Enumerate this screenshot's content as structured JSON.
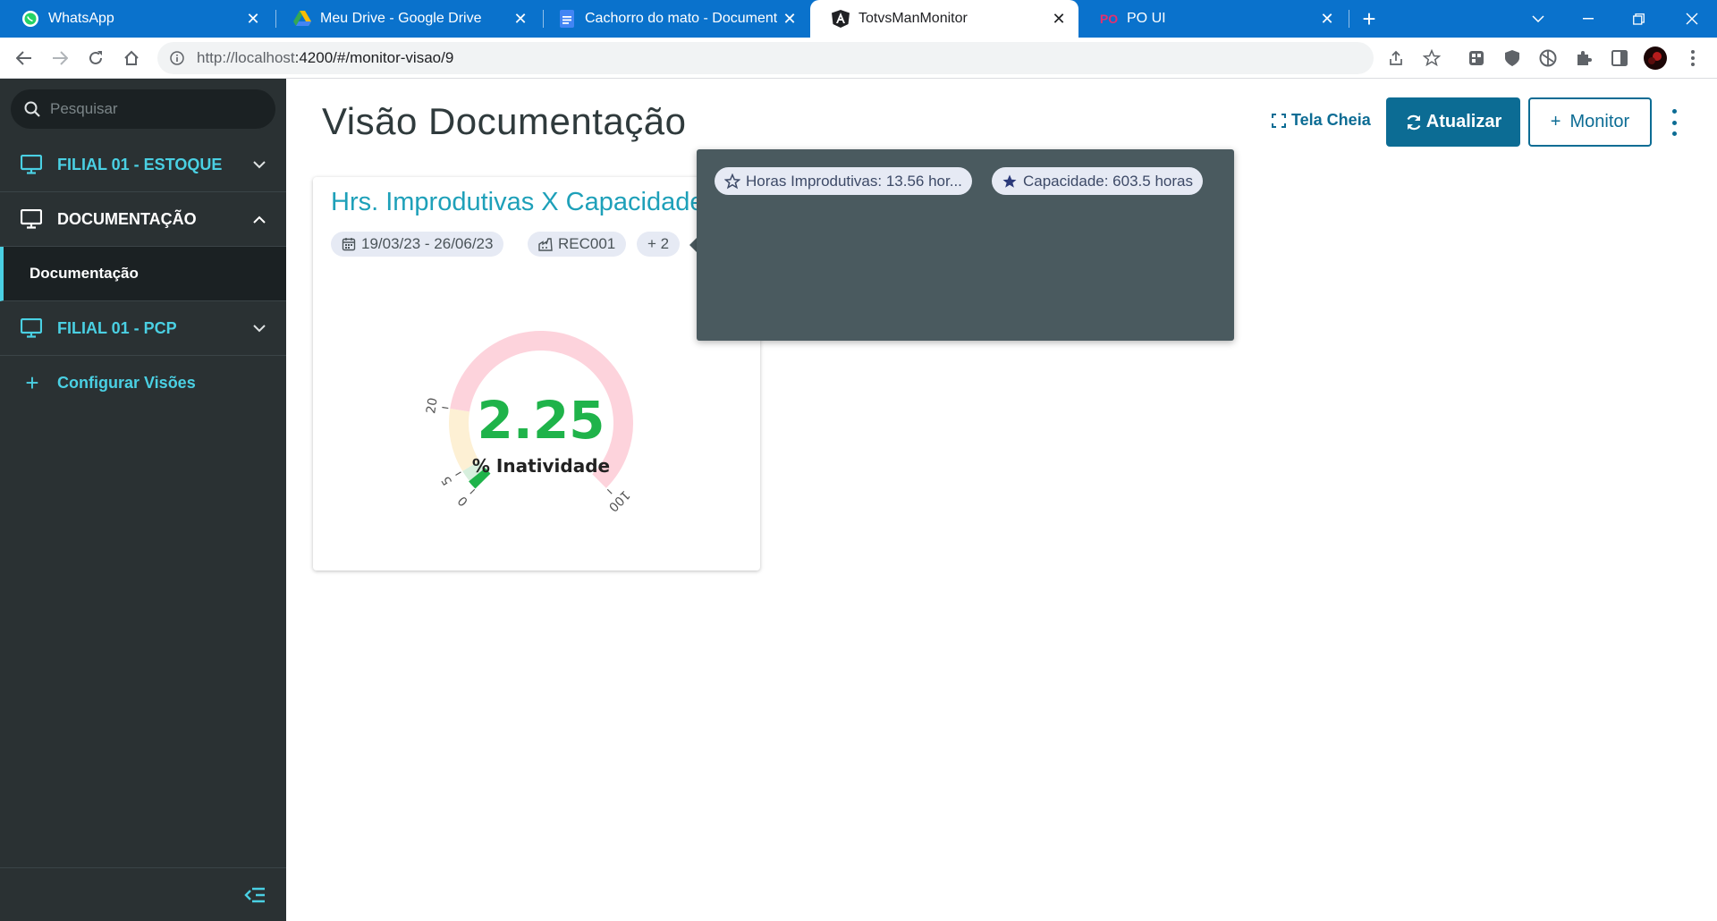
{
  "browser": {
    "tabs": [
      {
        "label": "WhatsApp",
        "icon": "whatsapp-icon"
      },
      {
        "label": "Meu Drive - Google Drive",
        "icon": "google-drive-icon"
      },
      {
        "label": "Cachorro do mato - Documentos",
        "icon": "google-docs-icon"
      },
      {
        "label": "TotvsManMonitor",
        "icon": "angular-icon",
        "active": true
      },
      {
        "label": "PO UI",
        "icon": "po-ui-icon"
      }
    ],
    "new_tab_glyph": "+",
    "url": {
      "host": "http://localhost",
      "path": ":4200/#/monitor-visao/9"
    }
  },
  "sidebar": {
    "search_placeholder": "Pesquisar",
    "items": [
      {
        "label": "FILIAL 01 - ESTOQUE",
        "expanded": false
      },
      {
        "label": "DOCUMENTAÇÃO",
        "expanded": true
      },
      {
        "label": "FILIAL 01 - PCP",
        "expanded": false
      }
    ],
    "sub_item": "Documentação",
    "configure_label": "Configurar Visões"
  },
  "header": {
    "title": "Visão Documentação",
    "fullscreen_label": "Tela Cheia",
    "update_label": "Atualizar",
    "monitor_label": "Monitor",
    "monitor_plus": "+"
  },
  "card": {
    "title": "Hrs. Improdutivas X Capacidade",
    "chips": {
      "date_range": "19/03/23 - 26/06/23",
      "resource": "REC001",
      "more": "+ 2"
    },
    "gauge": {
      "value": "2.25",
      "value_number": 2.25,
      "label": "% Inatividade",
      "min": 0,
      "max": 100,
      "ticks": [
        "0",
        "5",
        "20",
        "100"
      ],
      "bands": [
        {
          "from": 0,
          "to": 5,
          "color": "#d7efdd"
        },
        {
          "from": 5,
          "to": 20,
          "color": "#fdf0d4"
        },
        {
          "from": 20,
          "to": 100,
          "color": "#fdd3dc"
        }
      ],
      "value_color": "#1fb34a"
    }
  },
  "popover": {
    "items": [
      {
        "label": "Horas Improdutivas: 13.56 hor...",
        "icon": "star-outline-icon"
      },
      {
        "label": "Capacidade: 603.5 horas",
        "icon": "star-filled-icon"
      }
    ]
  },
  "colors": {
    "tab_strip": "#0a72cc",
    "sidebar": "#2a3133",
    "accent_teal": "#4ad0e3",
    "primary": "#0c6c94",
    "popover": "#4a5a5f"
  }
}
